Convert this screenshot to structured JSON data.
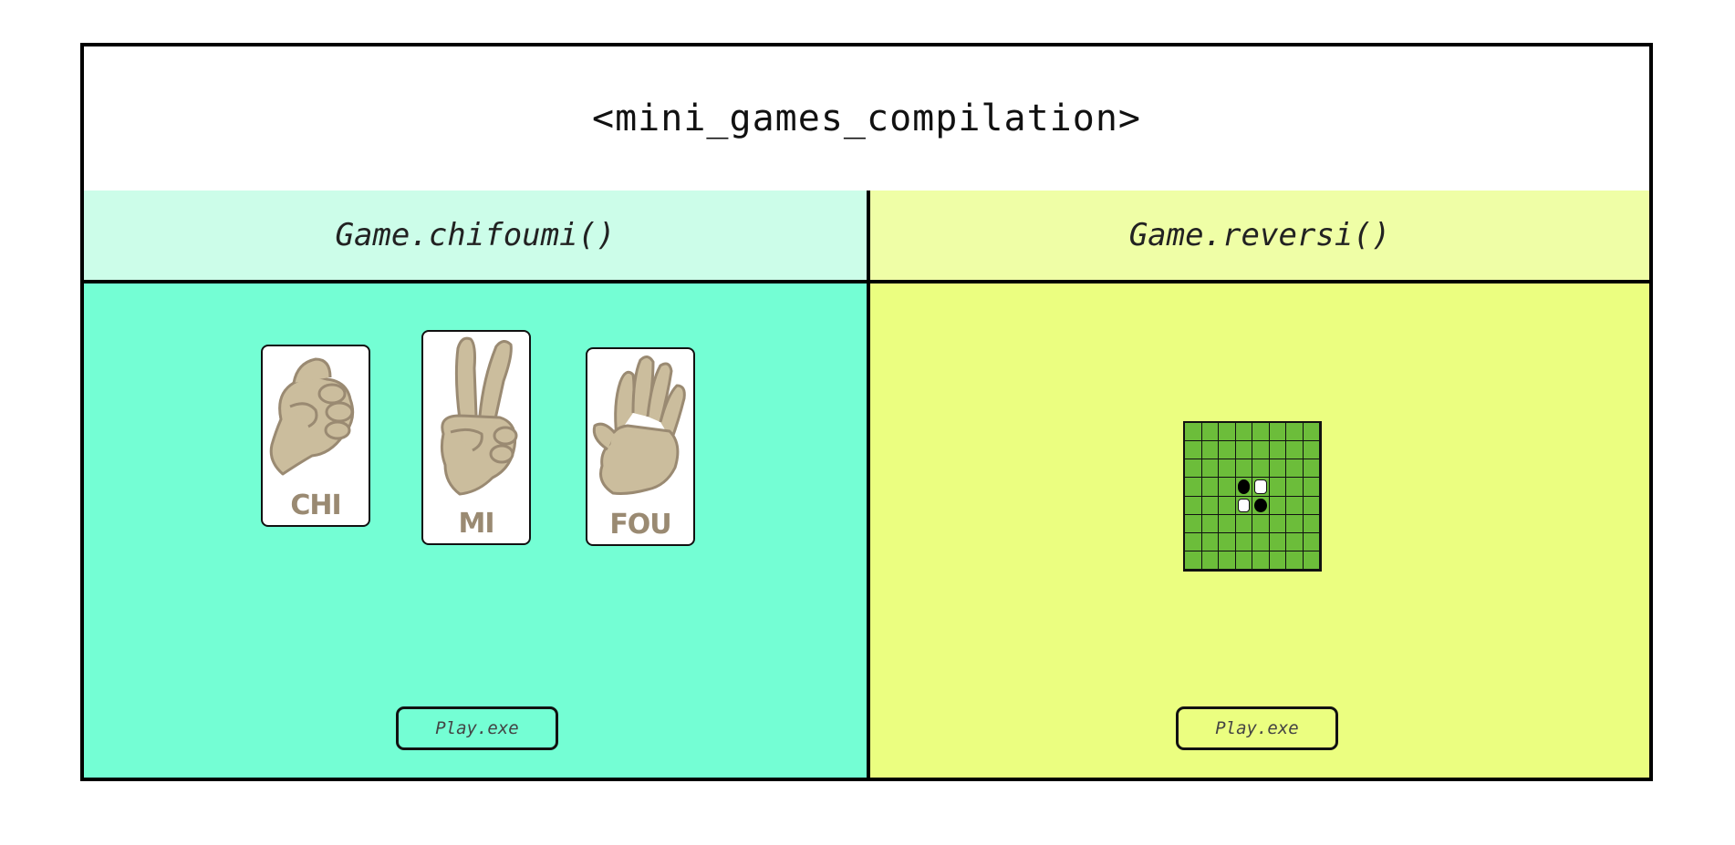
{
  "page": {
    "title": "<mini_games_compilation>"
  },
  "games": {
    "chifoumi": {
      "header": "Game.chifoumi()",
      "cards": [
        {
          "label": "CHI",
          "icon": "rock-fist-icon"
        },
        {
          "label": "MI",
          "icon": "scissors-hand-icon"
        },
        {
          "label": "FOU",
          "icon": "paper-hand-icon"
        }
      ],
      "play_label": "Play.exe"
    },
    "reversi": {
      "header": "Game.reversi()",
      "board": {
        "size": 8,
        "discs": [
          {
            "row": 3,
            "col": 3,
            "color": "black"
          },
          {
            "row": 3,
            "col": 4,
            "color": "white"
          },
          {
            "row": 4,
            "col": 3,
            "color": "white"
          },
          {
            "row": 4,
            "col": 4,
            "color": "black"
          }
        ]
      },
      "play_label": "Play.exe"
    }
  },
  "colors": {
    "chifoumi_header": "#ccfde9",
    "chifoumi_body": "#74fed4",
    "reversi_header": "#effea6",
    "reversi_body": "#ebfe80",
    "board_green": "#6cbd3a",
    "hand_skin": "#cbbd9d",
    "hand_outline": "#9a8a72"
  }
}
